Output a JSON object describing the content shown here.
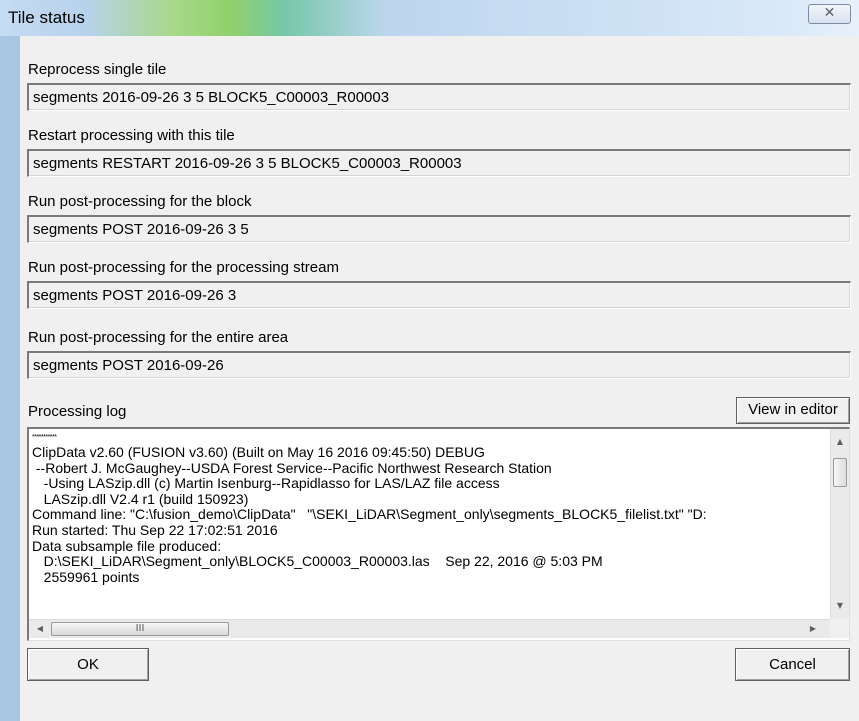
{
  "window": {
    "title": "Tile status",
    "close_glyph": "✕"
  },
  "fields": [
    {
      "label": "Reprocess single tile",
      "value": "segments 2016-09-26 3 5 BLOCK5_C00003_R00003"
    },
    {
      "label": "Restart processing with this tile",
      "value": "segments RESTART 2016-09-26 3 5 BLOCK5_C00003_R00003"
    },
    {
      "label": "Run post-processing for the block",
      "value": "segments POST 2016-09-26 3 5"
    },
    {
      "label": "Run post-processing for the processing stream",
      "value": "segments POST 2016-09-26 3"
    },
    {
      "label": "Run post-processing for the entire area",
      "value": "segments POST 2016-09-26"
    }
  ],
  "log": {
    "label": "Processing log",
    "view_button": "View in editor",
    "lines": [
      "***********",
      "ClipData v2.60 (FUSION v3.60) (Built on May 16 2016 09:45:50) DEBUG",
      " --Robert J. McGaughey--USDA Forest Service--Pacific Northwest Research Station",
      "   -Using LASzip.dll (c) Martin Isenburg--Rapidlasso for LAS/LAZ file access",
      "   LASzip.dll V2.4 r1 (build 150923)",
      "Command line: \"C:\\fusion_demo\\ClipData\"   \"\\SEKI_LiDAR\\Segment_only\\segments_BLOCK5_filelist.txt\" \"D:",
      "Run started: Thu Sep 22 17:02:51 2016",
      "Data subsample file produced:",
      "   D:\\SEKI_LiDAR\\Segment_only\\BLOCK5_C00003_R00003.las    Sep 22, 2016 @ 5:03 PM",
      "   2559961 points"
    ],
    "scroll": {
      "up": "▲",
      "down": "▼",
      "left": "◀",
      "right": "▶",
      "grip": "III"
    }
  },
  "buttons": {
    "ok": "OK",
    "cancel": "Cancel"
  }
}
